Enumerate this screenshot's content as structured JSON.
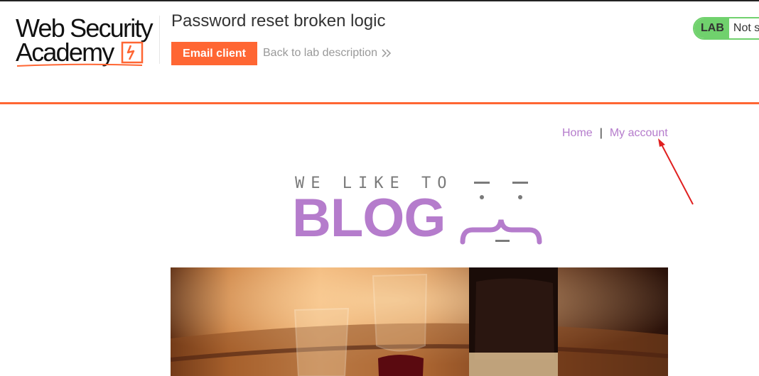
{
  "header": {
    "logo": {
      "line1": "Web Security",
      "line2": "Academy",
      "brand_color": "#ff6633"
    },
    "lab_title": "Password reset broken logic",
    "email_client_label": "Email client",
    "back_link_label": "Back to lab description",
    "lab_status": {
      "badge": "LAB",
      "status_text": "Not s",
      "color": "#70d16d"
    }
  },
  "nav": {
    "home_label": "Home",
    "separator": "|",
    "my_account_label": "My account",
    "link_color": "#b57ccc"
  },
  "blog_banner": {
    "small_text": "WE LIKE TO",
    "big_text": "BLOG",
    "accent_color": "#b57ccc"
  },
  "icons": {
    "back_chevron": "double-chevron-right-icon",
    "annotation": "red-arrow-icon"
  },
  "hero_image": {
    "subject": "wine-glasses-and-bottle-on-barrel"
  }
}
